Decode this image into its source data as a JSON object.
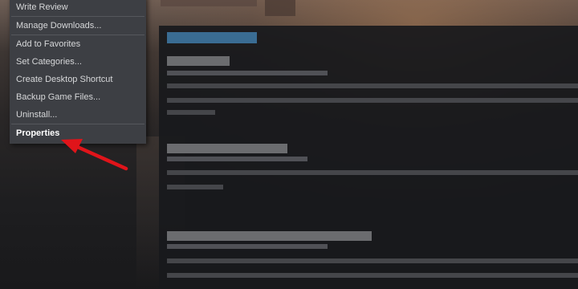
{
  "context_menu": {
    "items": [
      {
        "label": "Write Review"
      },
      {
        "label": "Manage Downloads..."
      },
      {
        "label": "Add to Favorites"
      },
      {
        "label": "Set Categories..."
      },
      {
        "label": "Create Desktop Shortcut"
      },
      {
        "label": "Backup Game Files..."
      },
      {
        "label": "Uninstall..."
      },
      {
        "label": "Properties"
      }
    ]
  },
  "colors": {
    "menu_background": "#3d3f44",
    "menu_text": "#d6d7d9",
    "annotation_arrow": "#e0141a",
    "panel_header": "#3a6c93"
  },
  "icons": {
    "annotation": "red-arrow-icon"
  }
}
